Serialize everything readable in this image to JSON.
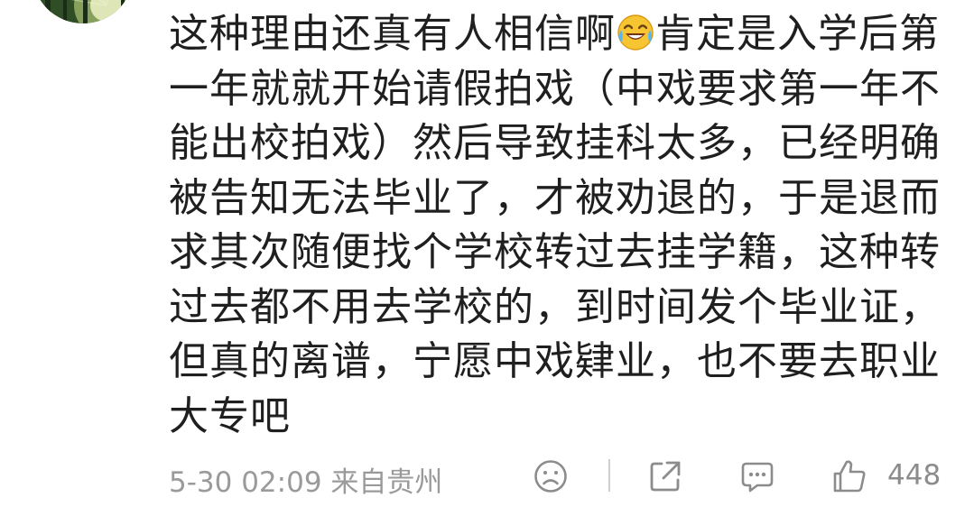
{
  "comment": {
    "text_before_emoji": "这种理由还真有人相信啊",
    "emoji_icon": "laugh-cry-emoji",
    "text_after_emoji": "肯定是入学后第一年就就开始请假拍戏（中戏要求第一年不能出校拍戏）然后导致挂科太多，已经明确被告知无法毕业了，才被劝退的，于是退而求其次随便找个学校转过去挂学籍，这种转过去都不用去学校的，到时间发个毕业证，但真的离谱，宁愿中戏肄业，也不要去职业大专吧"
  },
  "meta": {
    "timestamp": "5-30 02:09",
    "location": "来自贵州",
    "like_count": "448"
  },
  "icons": {
    "avatar": "forest-sunlight-avatar",
    "dislike": "frown-face-icon",
    "share": "share-icon",
    "reply": "comment-icon",
    "like": "thumbs-up-icon"
  },
  "colors": {
    "text": "#1f1f1f",
    "meta": "#9a9a9a",
    "icon": "#8c8c8c"
  }
}
